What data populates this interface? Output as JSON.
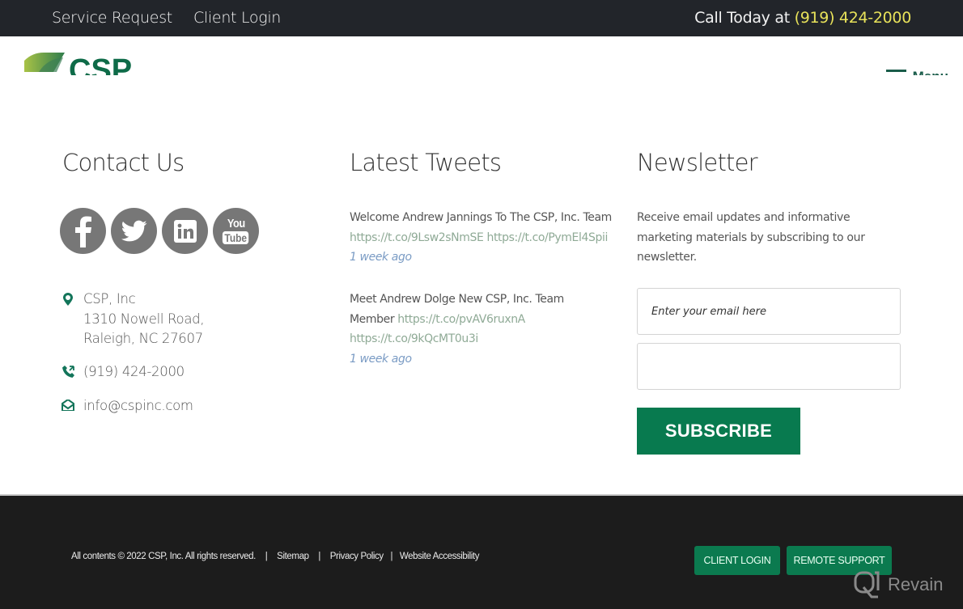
{
  "topbar": {
    "links": [
      {
        "label": "Service Request"
      },
      {
        "label": "Client Login"
      }
    ],
    "call_prefix": "Call Today at ",
    "call_phone": "(919) 424-2000"
  },
  "header": {
    "logo_text": "CSP",
    "menu_label": "Menu"
  },
  "contact": {
    "title": "Contact Us",
    "social": [
      {
        "name": "facebook",
        "icon": "facebook-icon"
      },
      {
        "name": "twitter",
        "icon": "twitter-icon"
      },
      {
        "name": "linkedin",
        "icon": "linkedin-icon"
      },
      {
        "name": "youtube",
        "icon": "youtube-icon",
        "label_top": "You",
        "label_bottom": "Tube"
      }
    ],
    "address_lines": [
      "CSP, Inc",
      "1310 Nowell Road,",
      "Raleigh, NC 27607"
    ],
    "phone": "(919) 424-2000",
    "email": "info@cspinc.com"
  },
  "tweets": {
    "title": "Latest Tweets",
    "items": [
      {
        "text": "Welcome Andrew Jannings To The CSP, Inc. Team",
        "links": [
          "https://t.co/9Lsw2sNmSE",
          "https://t.co/PymEl4Spii"
        ],
        "ago": "1 week ago"
      },
      {
        "text": "Meet Andrew Dolge New CSP, Inc. Team Member",
        "links": [
          "https://t.co/pvAV6ruxnA",
          "https://t.co/9kQcMT0u3i"
        ],
        "ago": "1 week ago"
      }
    ]
  },
  "newsletter": {
    "title": "Newsletter",
    "description": "Receive email updates and informative marketing materials by subscribing to our newsletter.",
    "email_placeholder": "Enter your email here",
    "second_field_value": "",
    "subscribe_label": "SUBSCRIBE"
  },
  "footer": {
    "copyright": "All contents © 2022 CSP, Inc. All rights reserved.",
    "separator": "|",
    "links": [
      {
        "label": "Sitemap"
      },
      {
        "label": "Privacy Policy"
      },
      {
        "label": "Website Accessibility"
      }
    ],
    "buttons": [
      {
        "label": "CLIENT LOGIN"
      },
      {
        "label": "REMOTE SUPPORT"
      }
    ],
    "watermark": "Revain"
  },
  "colors": {
    "brand_green": "#087a4f",
    "topbar_bg": "#22252a",
    "footer_bg": "#1c1c1c",
    "phone_highlight": "#e8e25a",
    "icon_gray": "#777777",
    "link_green": "#8faa96",
    "time_blue": "#7a9bc4"
  }
}
